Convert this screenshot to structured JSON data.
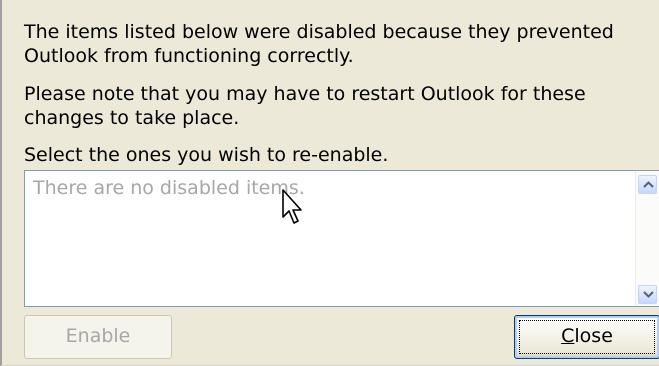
{
  "dialog": {
    "message_line1": "The items listed below were disabled because they prevented\nOutlook from functioning correctly.",
    "message_line2": "Please note that you may have to restart Outlook for these\nchanges to take place.",
    "message_line3": "Select the ones you wish to re-enable."
  },
  "list": {
    "empty_text": "There are no disabled items."
  },
  "buttons": {
    "enable_label": "Enable",
    "close_mnemonic": "C",
    "close_label_rest": "lose"
  },
  "icons": {
    "scroll_up": "chevron-up-icon",
    "scroll_down": "chevron-down-icon",
    "cursor": "mouse-pointer-icon"
  },
  "colors": {
    "dialog_bg": "#ece9d8",
    "disabled_text": "#a7a6aa",
    "list_border": "#7f9db9",
    "focus_border": "#003c74"
  }
}
